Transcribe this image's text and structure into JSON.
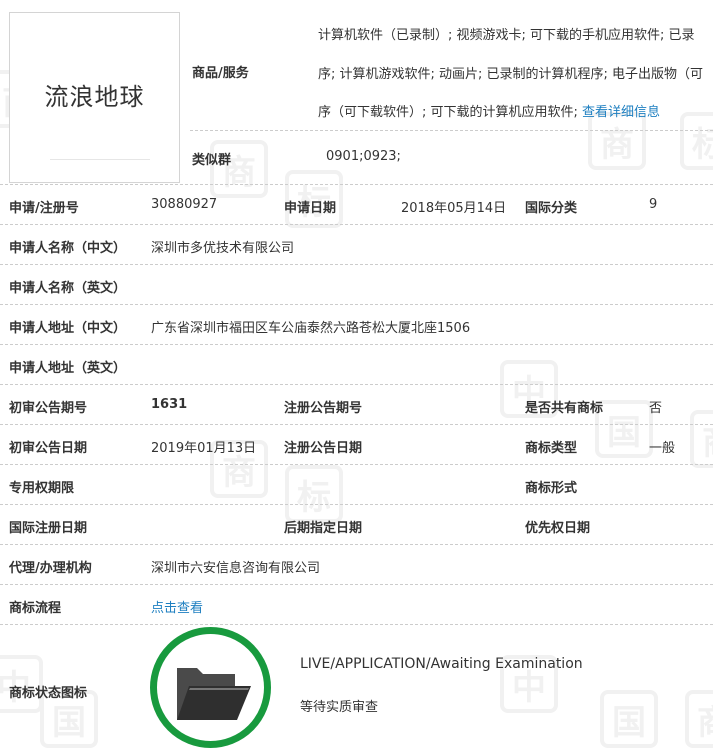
{
  "logo": {
    "text": "流浪地球"
  },
  "goods": {
    "label": "商品/服务",
    "lines": [
      "计算机软件（已录制）; 视频游戏卡; 可下载的手机应用软件; 已录",
      "序; 计算机游戏软件; 动画片; 已录制的计算机程序; 电子出版物（可",
      "序（可下载软件）; 可下载的计算机应用软件; "
    ],
    "detail_link": "查看详细信息"
  },
  "similar_group": {
    "label": "类似群",
    "value": "0901;0923;"
  },
  "fields": {
    "reg_no": {
      "label": "申请/注册号",
      "value": "30880927"
    },
    "apply_date": {
      "label": "申请日期",
      "value": "2018年05月14日"
    },
    "intl_class": {
      "label": "国际分类",
      "value": "9"
    },
    "applicant_cn": {
      "label": "申请人名称（中文）",
      "value": "深圳市多优技术有限公司"
    },
    "applicant_en": {
      "label": "申请人名称（英文）",
      "value": ""
    },
    "address_cn": {
      "label": "申请人地址（中文）",
      "value": "广东省深圳市福田区车公庙泰然六路苍松大厦北座1506"
    },
    "address_en": {
      "label": "申请人地址（英文）",
      "value": ""
    },
    "prelim_issue": {
      "label": "初审公告期号",
      "value": "1631"
    },
    "reg_issue": {
      "label": "注册公告期号",
      "value": ""
    },
    "shared": {
      "label": "是否共有商标",
      "value": "否"
    },
    "prelim_date": {
      "label": "初审公告日期",
      "value": "2019年01月13日"
    },
    "reg_date": {
      "label": "注册公告日期",
      "value": ""
    },
    "tm_type": {
      "label": "商标类型",
      "value": "一般"
    },
    "exclusive_period": {
      "label": "专用权期限",
      "value": ""
    },
    "tm_form": {
      "label": "商标形式",
      "value": ""
    },
    "intl_reg_date": {
      "label": "国际注册日期",
      "value": ""
    },
    "later_date": {
      "label": "后期指定日期",
      "value": ""
    },
    "priority_date": {
      "label": "优先权日期",
      "value": ""
    },
    "agent": {
      "label": "代理/办理机构",
      "value": "深圳市六安信息咨询有限公司"
    },
    "process": {
      "label": "商标流程",
      "link": "点击查看"
    }
  },
  "status": {
    "label": "商标状态图标",
    "en": "LIVE/APPLICATION/Awaiting Examination",
    "cn": "等待实质审查",
    "icon": "folder-icon",
    "ring_color": "#189a3e"
  },
  "colors": {
    "link": "#1e7fc0",
    "text": "#333333",
    "divider": "#cccccc"
  }
}
